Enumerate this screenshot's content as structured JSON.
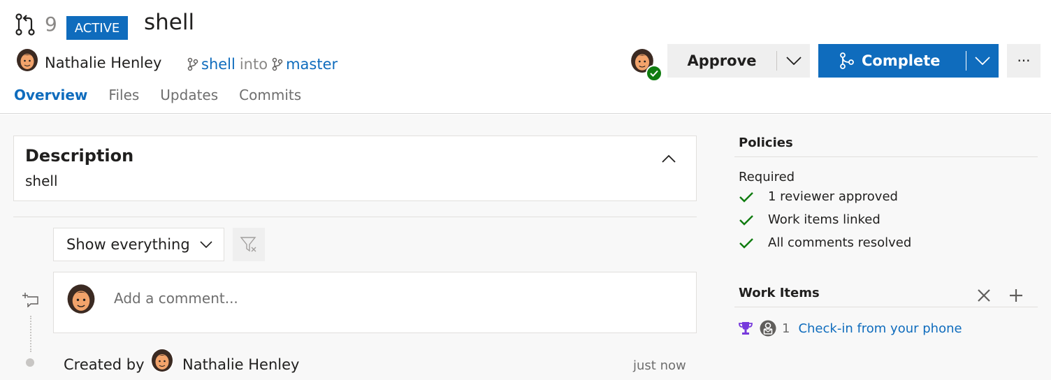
{
  "pr": {
    "number": "9",
    "status": "ACTIVE",
    "title": "shell",
    "author": "Nathalie Henley",
    "source_branch": "shell",
    "into": "into",
    "target_branch": "master"
  },
  "tabs": [
    "Overview",
    "Files",
    "Updates",
    "Commits"
  ],
  "actions": {
    "approve": "Approve",
    "complete": "Complete",
    "more": "···"
  },
  "description": {
    "title": "Description",
    "body": "shell"
  },
  "filter": {
    "selected": "Show everything"
  },
  "comment": {
    "placeholder": "Add a comment..."
  },
  "timeline": {
    "created_by": "Created by",
    "author": "Nathalie Henley",
    "time": "just now"
  },
  "policies": {
    "title": "Policies",
    "required_label": "Required",
    "items": [
      "1 reviewer approved",
      "Work items linked",
      "All comments resolved"
    ]
  },
  "work_items": {
    "title": "Work Items",
    "items": [
      {
        "id": "1",
        "title": "Check-in from your phone"
      }
    ]
  },
  "colors": {
    "accent": "#0f6cbd",
    "success": "#107c10",
    "trophy": "#773adc"
  }
}
